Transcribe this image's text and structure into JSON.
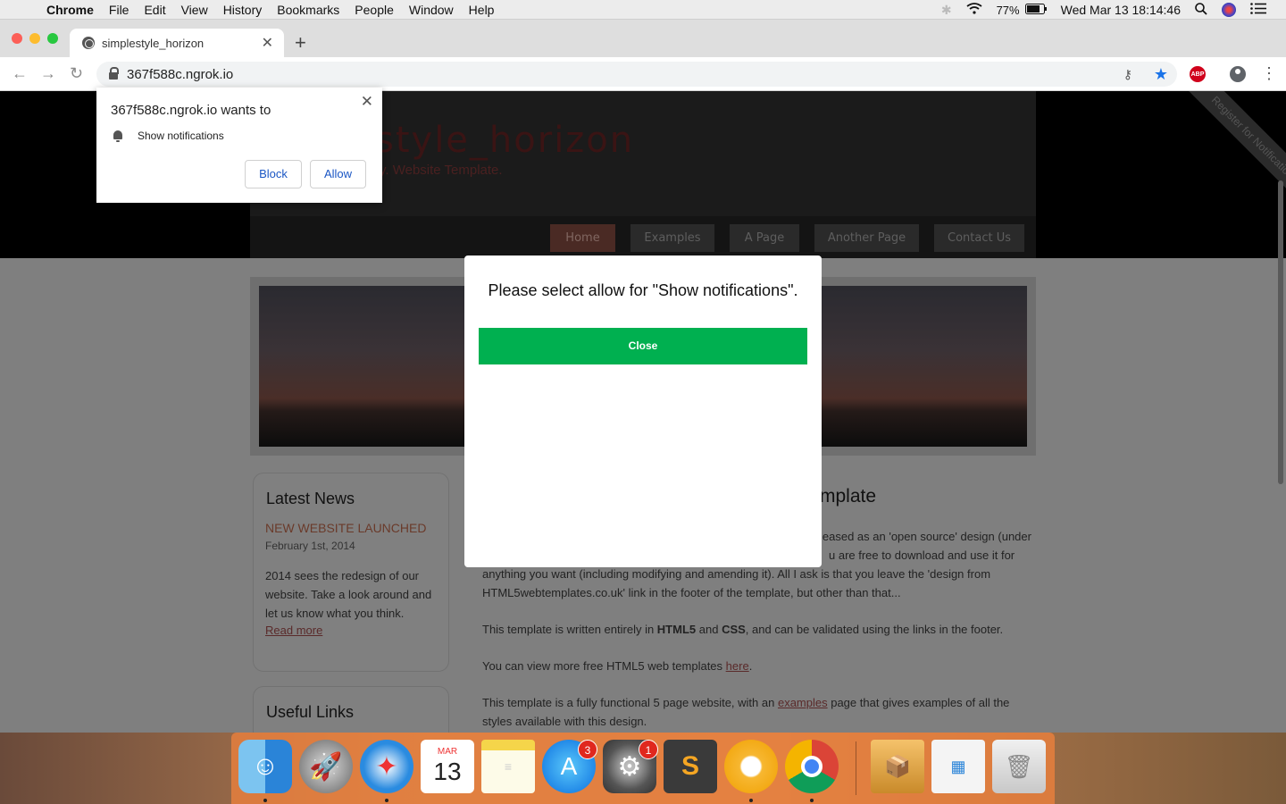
{
  "menubar": {
    "app": "Chrome",
    "items": [
      "File",
      "Edit",
      "View",
      "History",
      "Bookmarks",
      "People",
      "Window",
      "Help"
    ],
    "battery": "77%",
    "clock": "Wed Mar 13  18:14:46"
  },
  "browser": {
    "tab_title": "simplestyle_horizon",
    "url": "367f588c.ngrok.io"
  },
  "permission": {
    "title": "367f588c.ngrok.io wants to",
    "label": "Show notifications",
    "block": "Block",
    "allow": "Allow"
  },
  "site": {
    "title": "style_horizon",
    "slogan": "ry. Website Template.",
    "nav": [
      "Home",
      "Examples",
      "A Page",
      "Another Page",
      "Contact Us"
    ],
    "ribbon": "Register for Notifications",
    "sidebar": {
      "news_title": "Latest News",
      "news_headline": "NEW WEBSITE LAUNCHED",
      "news_date": "February 1st, 2014",
      "news_body": "2014 sees the redesign of our website. Take a look around and let us know what you think.",
      "news_more": "Read more",
      "links_title": "Useful Links"
    },
    "main": {
      "heading": "mplate",
      "p1_a": "leased as an 'open source' design (under",
      "p1_b": "u are free to download and use it for",
      "p1_c": "anything you want (including modifying and amending it). All I ask is that you leave the 'design from HTML5webtemplates.co.uk' link in the footer of the template, but other than that...",
      "p2_pre": "This template is written entirely in ",
      "p2_b1": "HTML5",
      "p2_mid": " and ",
      "p2_b2": "CSS",
      "p2_post": ", and can be validated using the links in the footer.",
      "p3_pre": "You can view more free HTML5 web templates ",
      "p3_link": "here",
      "p3_post": ".",
      "p4_pre": "This template is a fully functional 5 page website, with an ",
      "p4_link": "examples",
      "p4_post": " page that gives examples of all the styles available with this design."
    }
  },
  "modal": {
    "message": "Please select allow for \"Show notifications\".",
    "close": "Close"
  },
  "dock": {
    "calendar_month": "MAR",
    "calendar_day": "13",
    "appstore_badge": "3",
    "prefs_badge": "1"
  }
}
